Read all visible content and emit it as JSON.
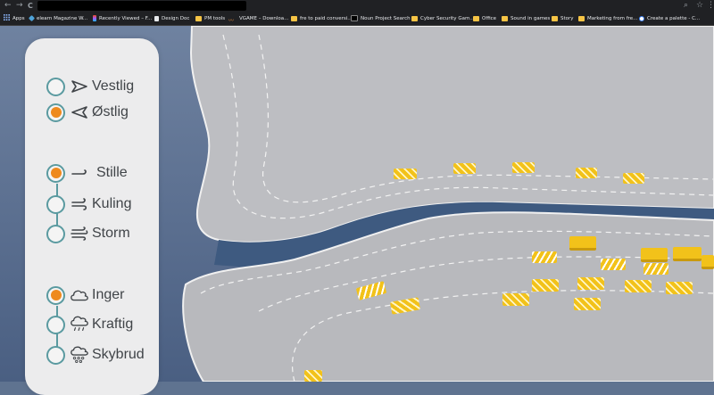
{
  "browser": {
    "back_glyph": "←",
    "forward_glyph": "→",
    "reload_glyph": "C",
    "zoom_glyph": "⌕",
    "star_glyph": "☆",
    "menu_glyph": "⋮",
    "bookmarks": [
      {
        "label": "Apps",
        "icon": "apps-grid-icon"
      },
      {
        "label": "elearn Magazine W...",
        "icon": "site-icon"
      },
      {
        "label": "Recently Viewed – F...",
        "icon": "figma-icon"
      },
      {
        "label": "Design Doc",
        "icon": "doc-icon"
      },
      {
        "label": "PM tools",
        "icon": "folder-icon"
      },
      {
        "label": "VGAME – Downloa...",
        "icon": "site-icon"
      },
      {
        "label": "fre to paid conversi...",
        "icon": "folder-icon"
      },
      {
        "label": "Noun Project Search",
        "icon": "noun-icon"
      },
      {
        "label": "Cyber Security Gam...",
        "icon": "folder-icon"
      },
      {
        "label": "Office",
        "icon": "folder-icon"
      },
      {
        "label": "Sound in games",
        "icon": "folder-icon"
      },
      {
        "label": "Story",
        "icon": "folder-icon"
      },
      {
        "label": "Marketing from fre...",
        "icon": "folder-icon"
      },
      {
        "label": "Create a palette - C...",
        "icon": "chrome-icon"
      }
    ]
  },
  "panel": {
    "direction": [
      {
        "label": "Vestlig",
        "icon": "arrow-east-icon",
        "selected": false
      },
      {
        "label": "Østlig",
        "icon": "arrow-west-icon",
        "selected": true
      }
    ],
    "wind": [
      {
        "label": "Stille",
        "icon": "wind-calm-icon",
        "selected": true
      },
      {
        "label": "Kuling",
        "icon": "wind-gale-icon",
        "selected": false
      },
      {
        "label": "Storm",
        "icon": "wind-storm-icon",
        "selected": false
      }
    ],
    "rain": [
      {
        "label": "Inger",
        "icon": "cloud-icon",
        "selected": true
      },
      {
        "label": "Kraftig",
        "icon": "cloud-rain-icon",
        "selected": false
      },
      {
        "label": "Skybrud",
        "icon": "cloud-heavy-rain-icon",
        "selected": false
      }
    ]
  },
  "colors": {
    "accent": "#ee8a1e",
    "radio_ring": "#5a9aa0",
    "car_yellow": "#f2c21a",
    "road": "#b8b9bd",
    "water": "#3e5a80"
  }
}
